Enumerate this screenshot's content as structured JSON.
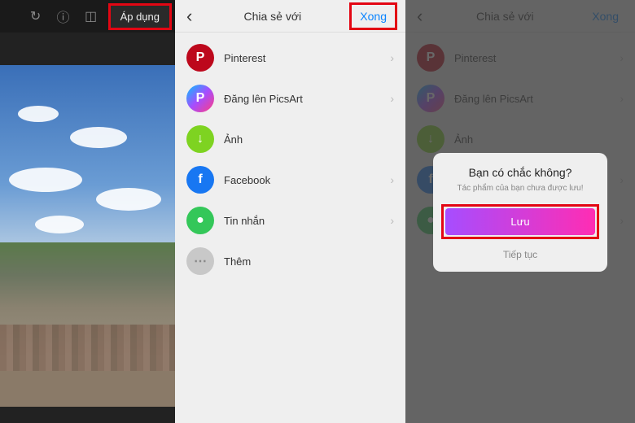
{
  "panel1": {
    "apply_label": "Áp dụng"
  },
  "share_sheet": {
    "title": "Chia sẻ với",
    "done_label": "Xong",
    "items": [
      {
        "label": "Pinterest",
        "icon": "P"
      },
      {
        "label": "Đăng lên PicsArt",
        "icon": "P"
      },
      {
        "label": "Ảnh",
        "icon": "↓"
      },
      {
        "label": "Facebook",
        "icon": "f"
      },
      {
        "label": "Tin nhắn",
        "icon": "●"
      },
      {
        "label": "Thêm",
        "icon": "⋯"
      }
    ]
  },
  "dialog": {
    "title": "Bạn có chắc không?",
    "subtitle": "Tác phẩm của bạn chưa được lưu!",
    "save_label": "Lưu",
    "continue_label": "Tiếp tục"
  }
}
